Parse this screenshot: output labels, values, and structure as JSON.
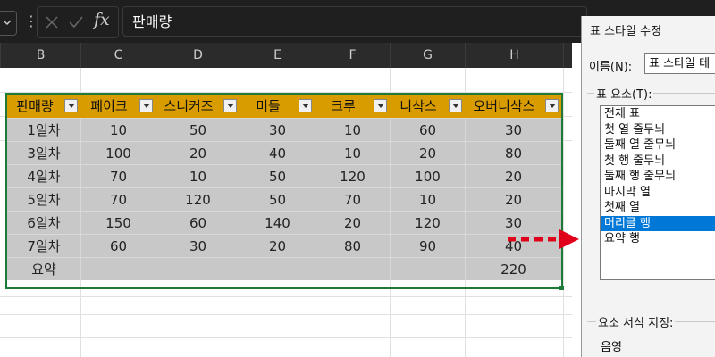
{
  "formula_bar": {
    "fx_label": "fx",
    "value": "판매량"
  },
  "columns": [
    "B",
    "C",
    "D",
    "E",
    "F",
    "G",
    "H"
  ],
  "table": {
    "headers": [
      "판매량",
      "페이크",
      "스니커즈",
      "미들",
      "크루",
      "니삭스",
      "오버니삭스"
    ],
    "rows": [
      [
        "1일차",
        "10",
        "50",
        "30",
        "10",
        "60",
        "30"
      ],
      [
        "3일차",
        "100",
        "20",
        "40",
        "10",
        "20",
        "80"
      ],
      [
        "4일차",
        "70",
        "10",
        "50",
        "120",
        "100",
        "20"
      ],
      [
        "5일차",
        "70",
        "120",
        "50",
        "70",
        "10",
        "20"
      ],
      [
        "6일차",
        "150",
        "60",
        "140",
        "20",
        "120",
        "30"
      ],
      [
        "7일차",
        "60",
        "30",
        "20",
        "80",
        "90",
        "40"
      ],
      [
        "요약",
        "",
        "",
        "",
        "",
        "",
        "220"
      ]
    ],
    "header_color": "#d89c00",
    "body_color": "#c8c8c8"
  },
  "panel": {
    "title": "표 스타일 수정",
    "name_label": "이름(N):",
    "name_value": "표 스타일 테",
    "elements_label": "표 요소(T):",
    "items": [
      "전체 표",
      "첫 열 줄무늬",
      "둘째 열 줄무늬",
      "첫 행 줄무늬",
      "둘째 행 줄무늬",
      "마지막 열",
      "첫째 열",
      "머리글 행",
      "요약 행"
    ],
    "selected_index": 7,
    "format_label": "요소 서식 지정:",
    "shading_label": "음영"
  },
  "colors": {
    "accent_red": "#e0001a",
    "selection_blue": "#0078d7",
    "table_border": "#1f7a3a"
  }
}
